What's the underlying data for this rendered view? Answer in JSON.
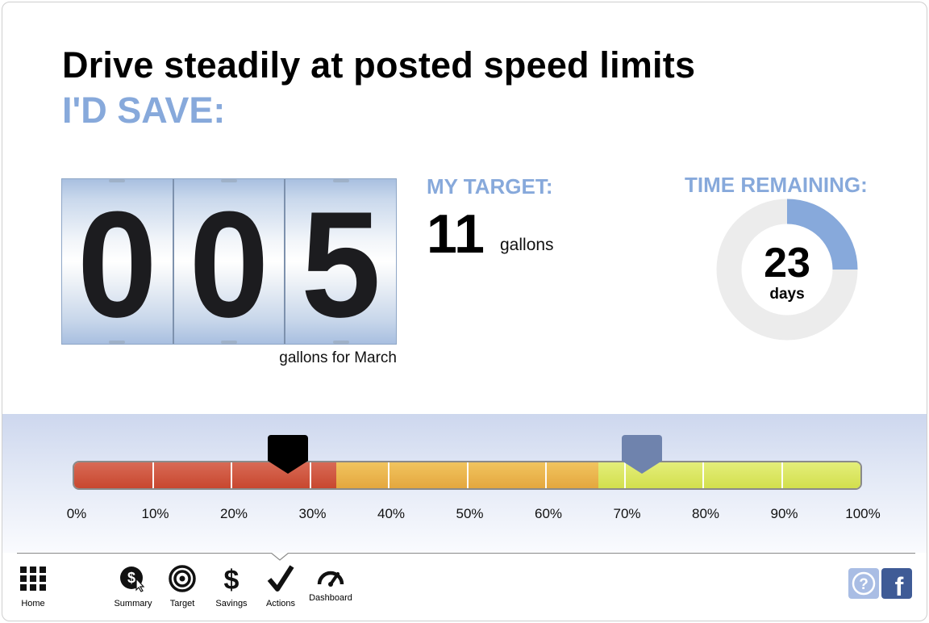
{
  "headline": "Drive steadily at posted speed limits",
  "subhead": "I'D SAVE:",
  "savings": {
    "digits": [
      "0",
      "0",
      "5"
    ],
    "caption": "gallons for March"
  },
  "target": {
    "label": "MY TARGET:",
    "value": "11",
    "unit": "gallons"
  },
  "time_remaining": {
    "label": "TIME REMAINING:",
    "value": "23",
    "unit": "days",
    "elapsed_fraction": 0.25
  },
  "progress": {
    "ticks": [
      "0%",
      "10%",
      "20%",
      "30%",
      "40%",
      "50%",
      "60%",
      "70%",
      "80%",
      "90%",
      "100%"
    ],
    "segment_breaks_percent": [
      33.3,
      66.7
    ],
    "current_marker_percent": 27.2,
    "target_marker_percent": 72.2,
    "colors": {
      "low": "#c8472f",
      "mid": "#e4a73e",
      "high": "#d2df4d",
      "current_marker": "#000000",
      "target_marker": "#6f83ad"
    }
  },
  "nav": {
    "home": {
      "label": "Home",
      "icon": "grid-icon"
    },
    "summary": {
      "label": "Summary",
      "icon": "dollar-cursor-icon"
    },
    "target": {
      "label": "Target",
      "icon": "target-icon"
    },
    "savings": {
      "label": "Savings",
      "icon": "dollar-icon"
    },
    "actions": {
      "label": "Actions",
      "icon": "checkmark-icon"
    },
    "dashboard": {
      "label": "Dashboard",
      "icon": "speedometer-icon"
    },
    "help": {
      "icon": "help-icon"
    },
    "facebook": {
      "icon": "facebook-icon"
    }
  }
}
